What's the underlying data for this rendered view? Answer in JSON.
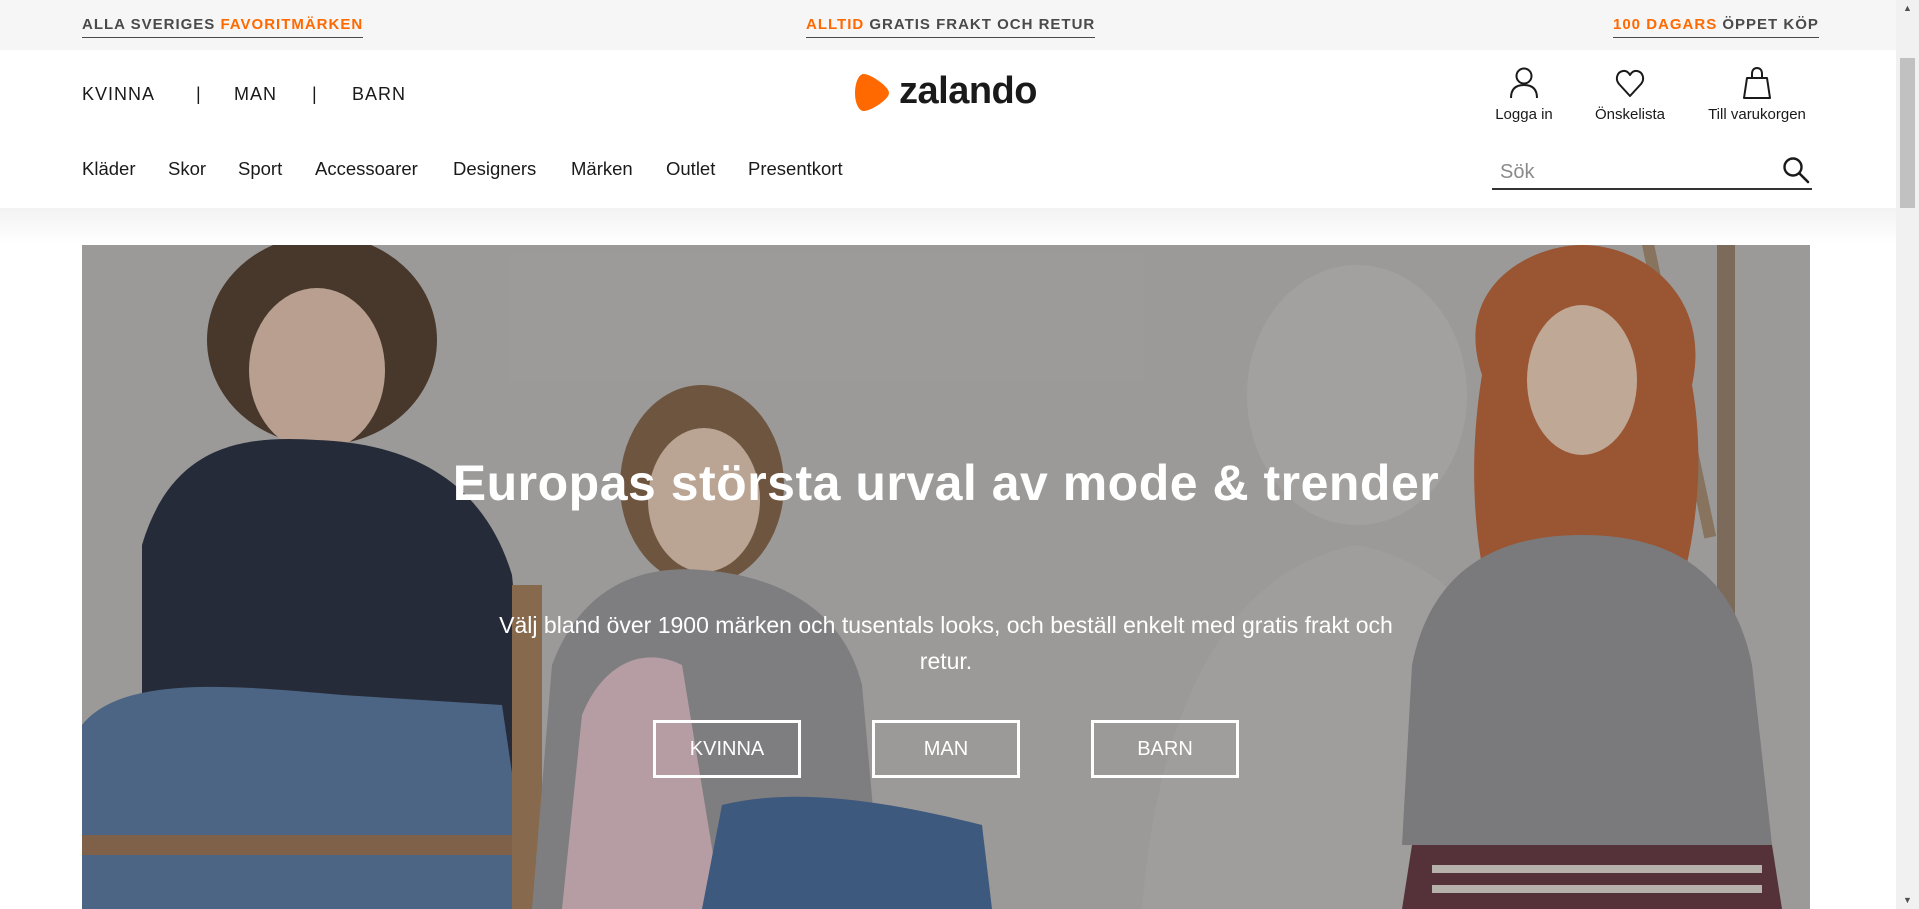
{
  "promo": {
    "left_prefix": "ALLA SVERIGES ",
    "left_accent": "FAVORITMÄRKEN",
    "center_accent": "ALLTID",
    "center_suffix": " GRATIS FRAKT OCH RETUR",
    "right_accent": "100 DAGARS",
    "right_suffix": " ÖPPET KÖP",
    "accent_color": "#ff6900"
  },
  "gender_nav": {
    "items": [
      "KVINNA",
      "MAN",
      "BARN"
    ],
    "separator": "|"
  },
  "logo": {
    "text": "zalando",
    "mark_color": "#ff6900",
    "icon": "zalando-logo-icon"
  },
  "user_actions": [
    {
      "label": "Logga in",
      "icon": "user-icon"
    },
    {
      "label": "Önskelista",
      "icon": "heart-icon"
    },
    {
      "label": "Till varukorgen",
      "icon": "shopping-bag-icon"
    }
  ],
  "category_nav": [
    "Kläder",
    "Skor",
    "Sport",
    "Accessoarer",
    "Designers",
    "Märken",
    "Outlet",
    "Presentkort"
  ],
  "search": {
    "placeholder": "Sök",
    "value": "",
    "icon": "search-icon"
  },
  "hero": {
    "title": "Europas största urval av mode & trender",
    "subtitle": "Välj bland över 1900 märken och tusentals looks, och beställ enkelt med gratis frakt och retur.",
    "buttons": [
      "KVINNA",
      "MAN",
      "BARN"
    ]
  }
}
